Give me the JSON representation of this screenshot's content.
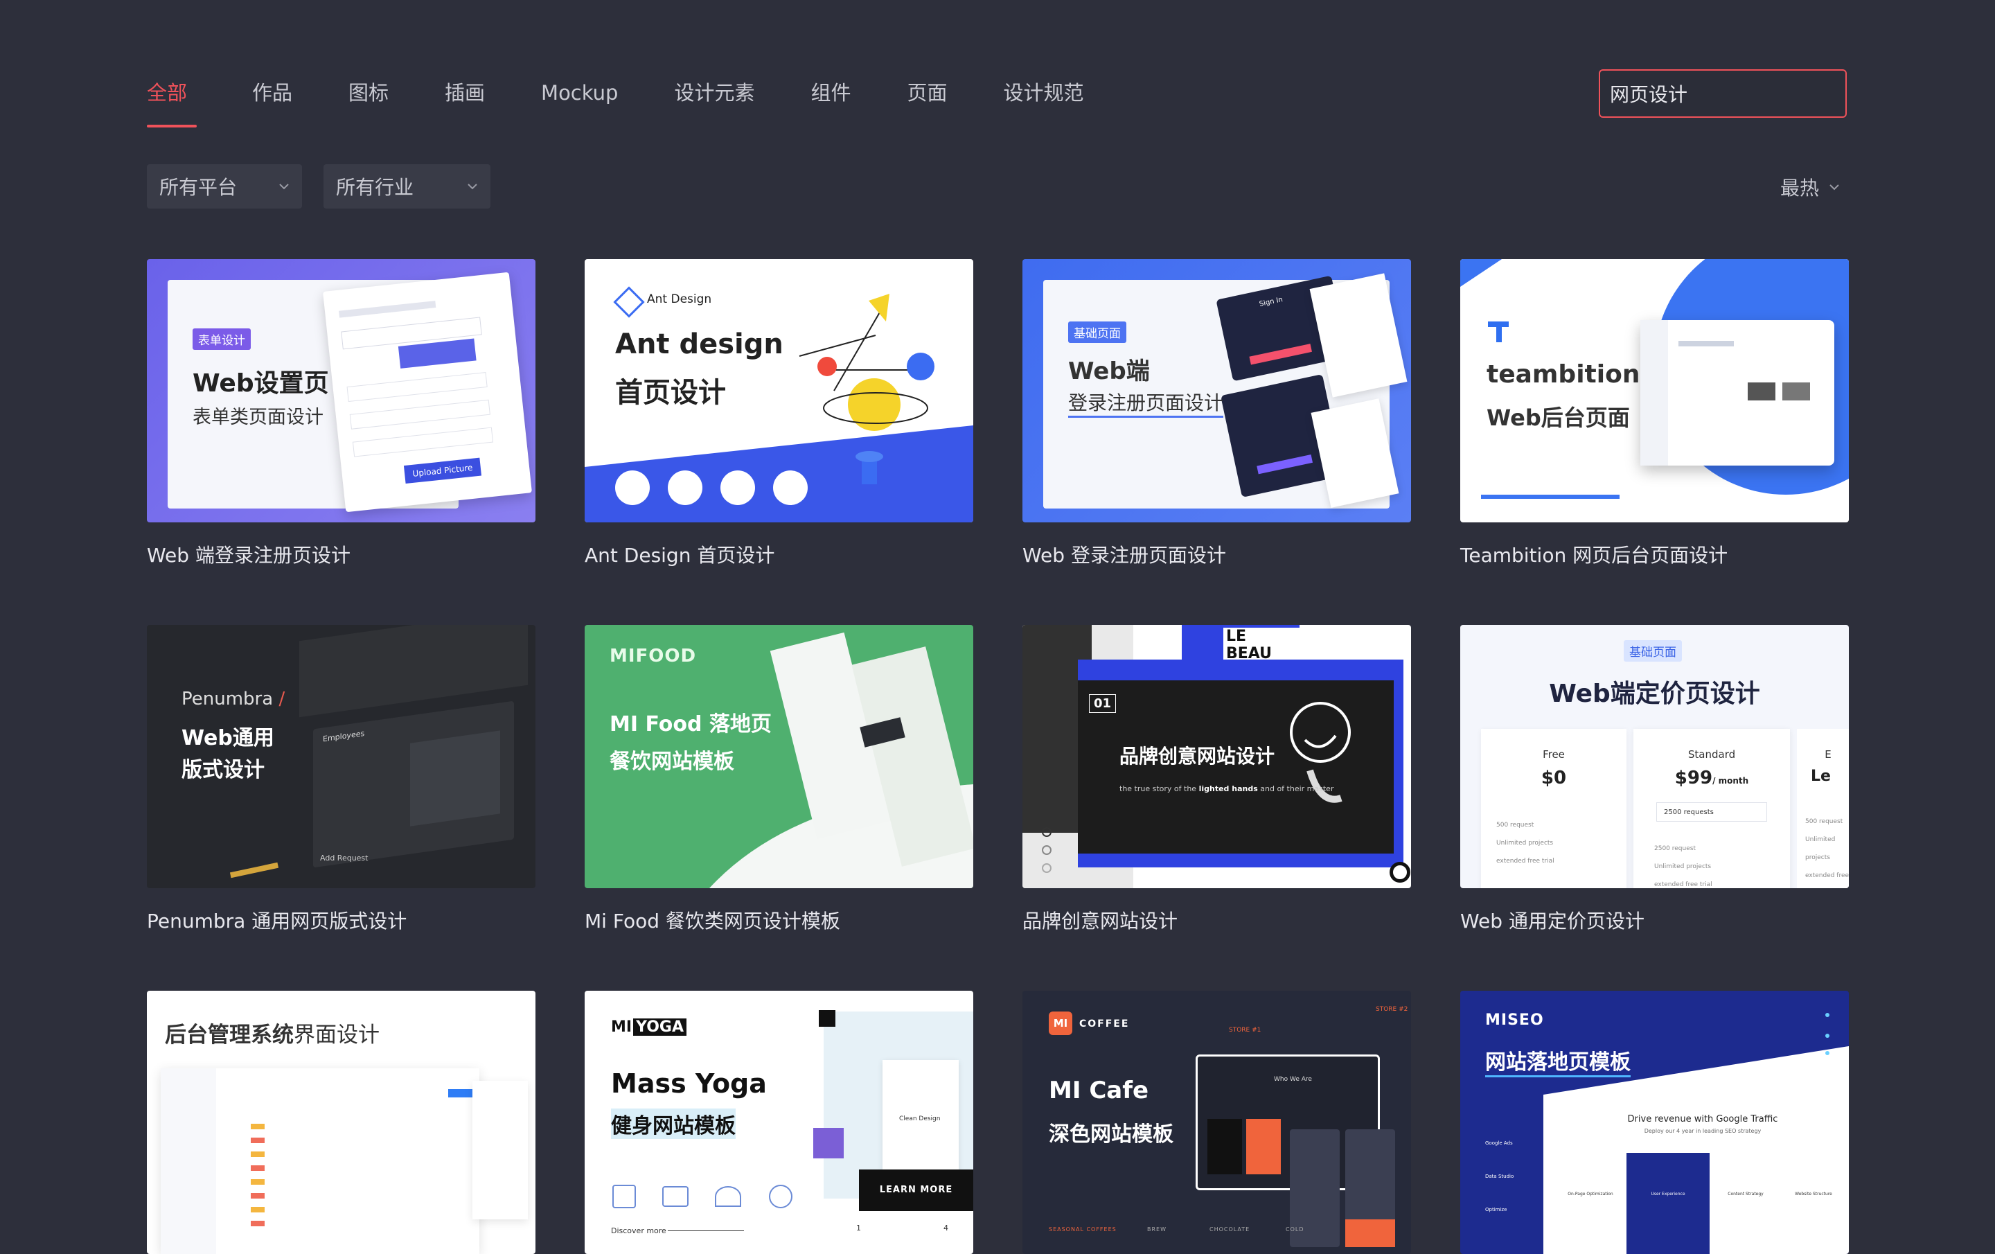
{
  "tabs": [
    "全部",
    "作品",
    "图标",
    "插画",
    "Mockup",
    "设计元素",
    "组件",
    "页面",
    "设计规范"
  ],
  "search": {
    "value": "网页设计"
  },
  "filters": {
    "platform": "所有平台",
    "industry": "所有行业",
    "sort": "最热"
  },
  "cards": [
    {
      "caption": "Web 端登录注册页设计",
      "badge": "表单设计",
      "title": "Web设置页",
      "subtitle": "表单类页面设计",
      "button": "Upload Picture"
    },
    {
      "caption": "Ant Design 首页设计",
      "brand": "Ant Design",
      "title": "Ant design",
      "subtitle": "首页设计"
    },
    {
      "caption": "Web 登录注册页面设计",
      "badge": "基础页面",
      "title": "Web端",
      "subtitle": "登录注册页面设计",
      "sign_in": "Sign In"
    },
    {
      "caption": "Teambition 网页后台页面设计",
      "title": "teambition",
      "subtitle": "Web后台页面"
    },
    {
      "caption": "Penumbra 通用网页版式设计",
      "brand": "Penumbra",
      "slash": "/",
      "title": "Web通用",
      "subtitle": "版式设计",
      "panel": "Employees",
      "add": "Add Request"
    },
    {
      "caption": "Mi Food 餐饮类网页设计模板",
      "brand": "MIFOOD",
      "title": "MI Food 落地页",
      "subtitle": "餐饮网站模板"
    },
    {
      "caption": "品牌创意网站设计",
      "num": "01",
      "title": "品牌创意网站设计",
      "tagline_pre": "the true story of the ",
      "tagline_bold": "lighted hands",
      "tagline_post": " and of their master",
      "poster": "LE BEAU"
    },
    {
      "caption": "Web 通用定价页设计",
      "badge": "基础页面",
      "title": "Web端定价页设计",
      "plans": [
        {
          "name": "Free",
          "price": "$0",
          "features": [
            "500 request",
            "Unlimited projects",
            "extended free trial"
          ]
        },
        {
          "name": "Standard",
          "price": "$99",
          "per": "/ month",
          "select": "2500 requests",
          "features": [
            "2500 request",
            "Unlimited projects",
            "extended free trial"
          ]
        },
        {
          "name": "E",
          "price": "Le",
          "features": [
            "500 request",
            "Unlimited projects",
            "extended free"
          ]
        }
      ]
    },
    {
      "caption": "",
      "title_bold": "后台管理系统",
      "title_rest": "界面设计"
    },
    {
      "caption": "",
      "brand_a": "MI",
      "brand_b": "YOGA",
      "title": "Mass Yoga",
      "subtitle": "健身网站模板",
      "cta": "LEARN MORE",
      "discover": "Discover more",
      "card_title": "Clean Design",
      "pages": [
        "1",
        "4"
      ]
    },
    {
      "caption": "",
      "badge": "MI",
      "brand": "COFFEE",
      "title": "MI Cafe",
      "subtitle": "深色网站模板",
      "store1": "STORE #1",
      "store2": "STORE #2",
      "who": "Who We Are",
      "footer": [
        "SEASONAL COFFEES",
        "BREW",
        "CHOCOLATE",
        "COLD"
      ]
    },
    {
      "caption": "",
      "brand": "MISEO",
      "title": "网站落地页模板",
      "headline": "Drive revenue with Google Traffic",
      "subhead": "Deploy our 4 year in leading SEO strategy",
      "features": [
        "On-Page Optimization",
        "User Experience",
        "Content Strategy",
        "Website Structure"
      ],
      "side": [
        "Google Ads",
        "Data Studio",
        "Optimize"
      ]
    }
  ],
  "colors": {
    "background": "#2d2f3b",
    "accent": "#f0525a",
    "ant_blue": "#3a57e8",
    "food_green": "#4fb06f",
    "tb_blue": "#2f6ff0",
    "miseo_navy": "#1d2b8f"
  },
  "icons": {
    "search": "search-icon",
    "chevron": "chevron-down-icon"
  }
}
